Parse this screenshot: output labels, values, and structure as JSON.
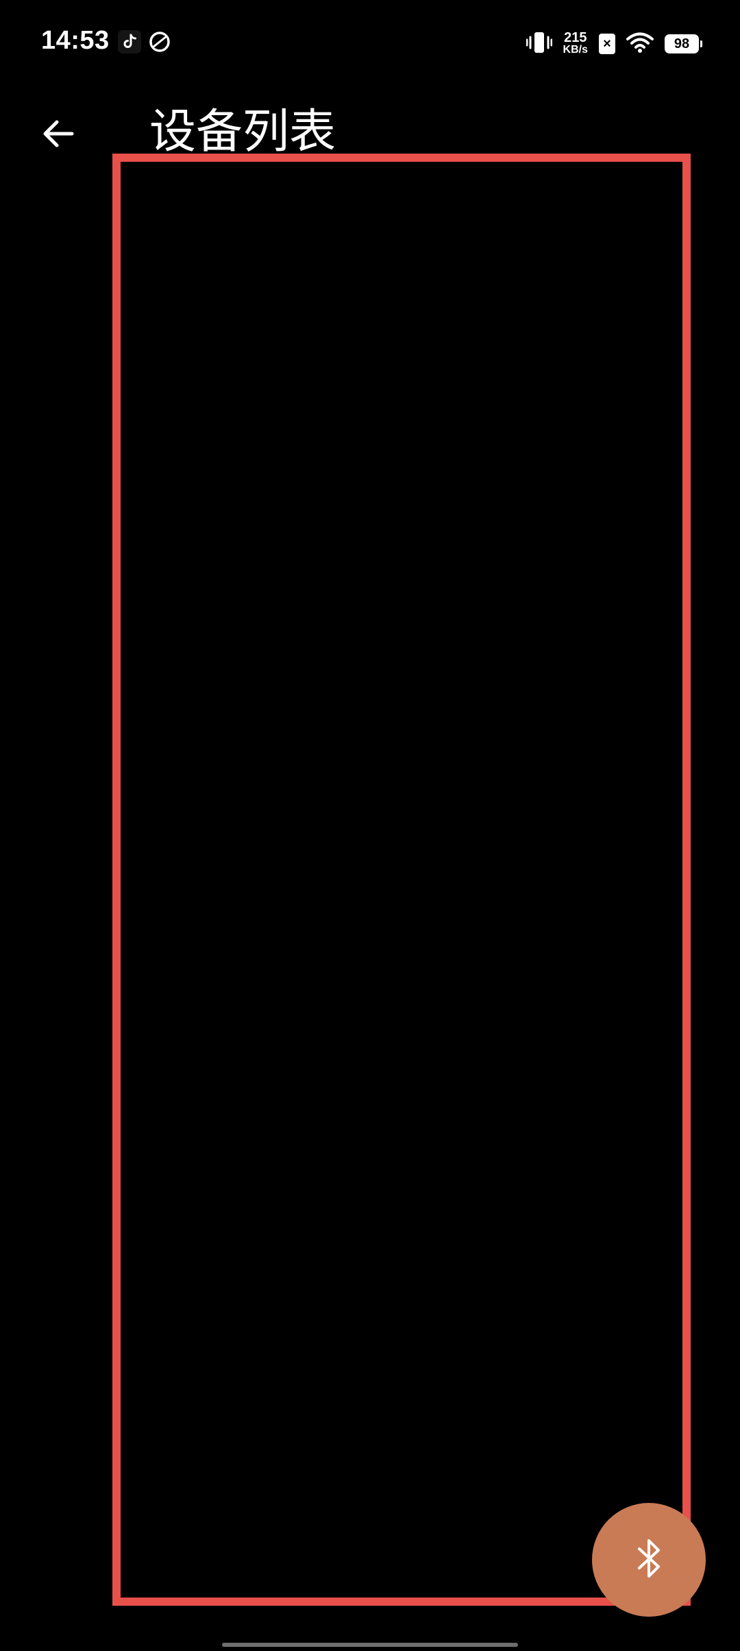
{
  "status_bar": {
    "time": "14:53",
    "net_speed_value": "215",
    "net_speed_unit": "KB/s",
    "sim_status": "×",
    "battery_level": "98",
    "icons": [
      "tiktok-icon",
      "app-notification-icon",
      "vibrate-icon",
      "wifi-icon",
      "battery-icon"
    ]
  },
  "toolbar": {
    "title": "设备列表",
    "back_icon": "arrow-left-icon"
  },
  "device_list": {
    "items": []
  },
  "fab": {
    "icon": "bluetooth-icon",
    "color": "#c97b55"
  },
  "colors": {
    "background": "#000000",
    "highlight_frame": "#e8504a",
    "text": "#ffffff"
  }
}
